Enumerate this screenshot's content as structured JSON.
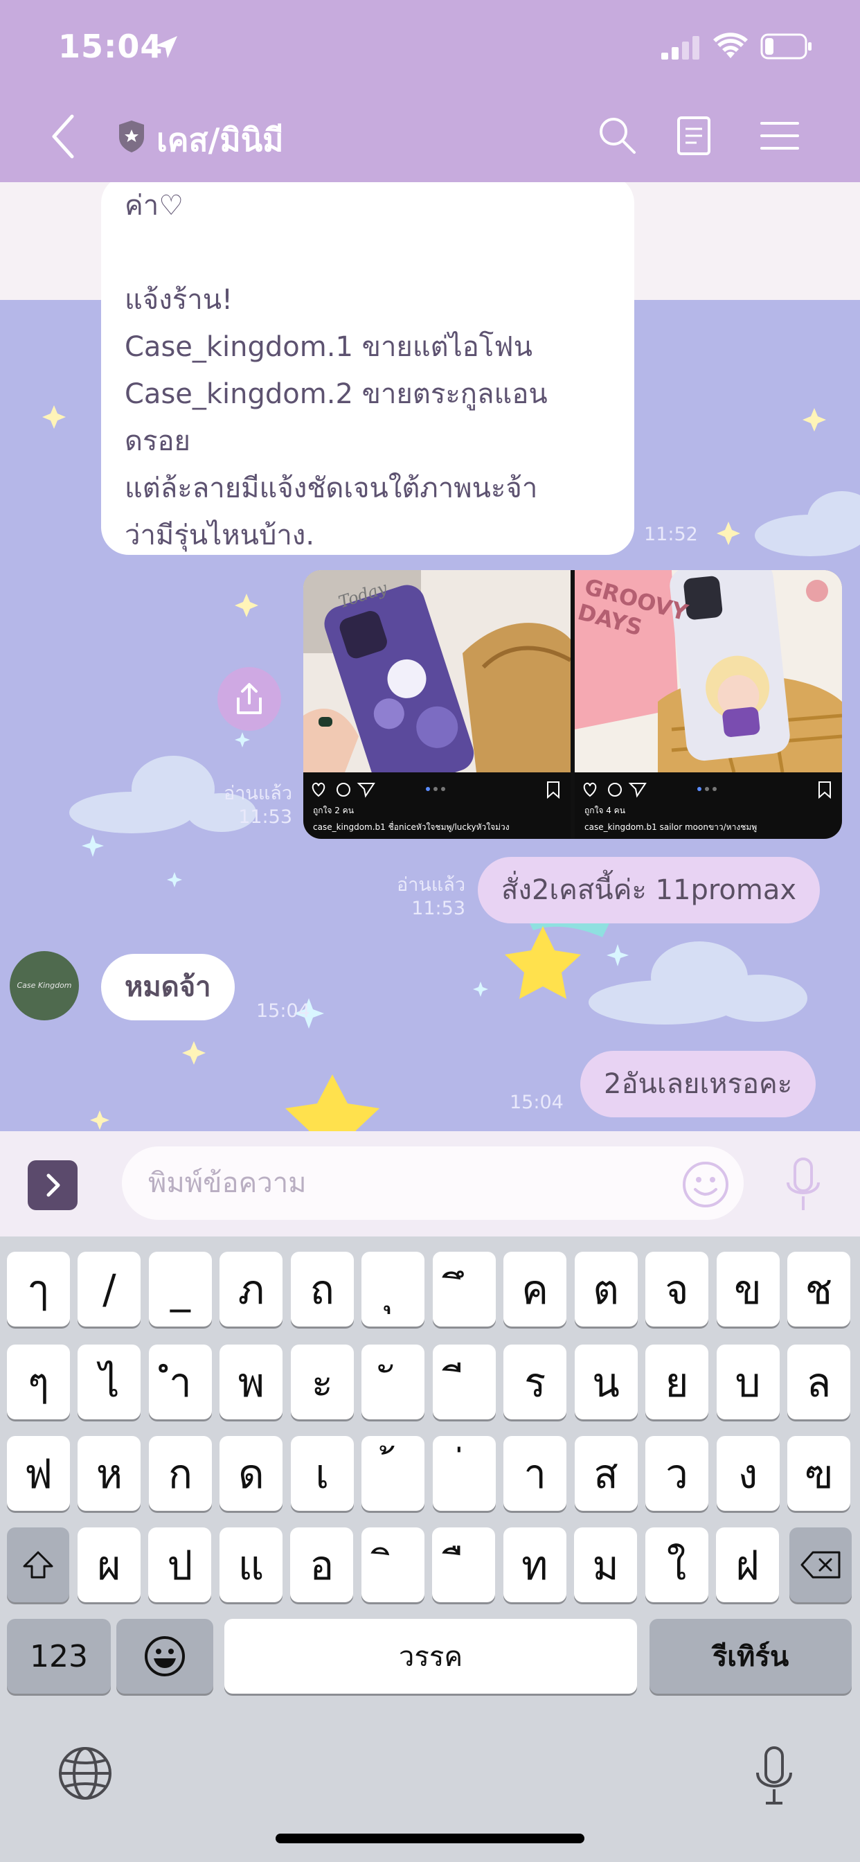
{
  "status_bar": {
    "time": "15:04"
  },
  "header": {
    "title": "เคส/มินิมี"
  },
  "messages": {
    "incoming_text": "ค่า♡\n\nแจ้งร้าน!\nCase_kingdom.1 ขายแต่ไอโฟน\nCase_kingdom.2 ขายตระกูลแอน\nดรอย\nแต่ล้ะลายมีแจ้งชัดเจนใต้ภาพนะจ้า\nว่ามีรุ่นไหนบ้าง.",
    "incoming_time": "11:52",
    "photo_read": "อ่านแล้ว",
    "photo_time": "11:53",
    "photos": [
      {
        "overlay_text": "Today",
        "likes": "ถูกใจ 2 คน",
        "caption": "case_kingdom.b1 ชื่อniceหัวใจชมพู/luckyหัวใจม่วง"
      },
      {
        "overlay_text": "GROOVY DAYS",
        "likes": "ถูกใจ 4 คน",
        "caption": "case_kingdom.b1 sailor moonขาว/หางชมพู"
      }
    ],
    "outgoing_1": "สั่ง2เคสนี้ค่ะ 11promax",
    "outgoing_1_read": "อ่านแล้ว",
    "outgoing_1_time": "11:53",
    "incoming_2": "หมดจ้า",
    "incoming_2_time": "15:04",
    "avatar_text": "Case Kingdom",
    "outgoing_2": "2อันเลยเหรอคะ",
    "outgoing_2_time": "15:04"
  },
  "input": {
    "placeholder": "พิมพ์ข้อความ"
  },
  "keyboard": {
    "row1": [
      "ๅ",
      "/",
      "_",
      "ภ",
      "ถ",
      "ุ",
      "ึ",
      "ค",
      "ต",
      "จ",
      "ข",
      "ช"
    ],
    "row2": [
      "ๆ",
      "ไ",
      "ำ",
      "พ",
      "ะ",
      "ั",
      "ี",
      "ร",
      "น",
      "ย",
      "บ",
      "ล"
    ],
    "row3": [
      "ฟ",
      "ห",
      "ก",
      "ด",
      "เ",
      "้",
      "่",
      "า",
      "ส",
      "ว",
      "ง",
      "ฃ"
    ],
    "row4": [
      "ผ",
      "ป",
      "แ",
      "อ",
      "ิ",
      "ื",
      "ท",
      "ม",
      "ใ",
      "ฝ"
    ],
    "numbers_key": "123",
    "space_key": "วรรค",
    "return_key": "รีเทิร์น"
  },
  "colors": {
    "header": "#c7abdd",
    "chat_bg": "#b5b7e8",
    "bubble_out": "#e8d3f3",
    "bubble_in": "#ffffff"
  }
}
